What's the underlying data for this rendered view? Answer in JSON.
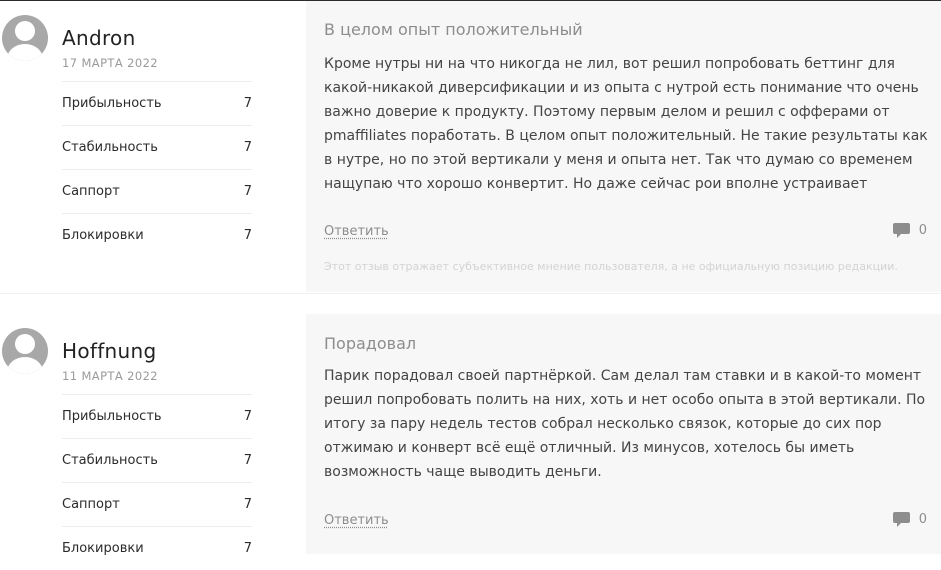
{
  "reviews": [
    {
      "author": "Andron",
      "date": "17 МАРТА 2022",
      "ratings": [
        {
          "label": "Прибыльность",
          "value": "7"
        },
        {
          "label": "Стабильность",
          "value": "7"
        },
        {
          "label": "Саппорт",
          "value": "7"
        },
        {
          "label": "Блокировки",
          "value": "7"
        }
      ],
      "title": "В целом опыт положительный",
      "text": "Кроме нутры ни на что никогда не лил, вот решил попробовать беттинг для какой-никакой диверсификации и из опыта с нутрой есть понимание что очень важно доверие к продукту. Поэтому первым делом и решил с офферами от pmaffiliates поработать. В целом опыт положительный. Не такие результаты как в нутре, но по этой вертикали у меня и опыта нет. Так что думаю со временем нащупаю что хорошо конвертит. Но даже сейчас рои вполне устраивает",
      "reply_label": "Ответить",
      "comment_count": "0",
      "disclaimer": "Этот отзыв отражает субъективное мнение пользователя, а не официальную позицию редакции."
    },
    {
      "author": "Hoffnung",
      "date": "11 МАРТА 2022",
      "ratings": [
        {
          "label": "Прибыльность",
          "value": "7"
        },
        {
          "label": "Стабильность",
          "value": "7"
        },
        {
          "label": "Саппорт",
          "value": "7"
        },
        {
          "label": "Блокировки",
          "value": "7"
        }
      ],
      "title": "Порадовал",
      "text": "Парик порадовал своей партнёркой. Сам делал там ставки и в какой-то момент решил попробовать полить на них, хоть и нет особо опыта в этой вертикали. По итогу за пару недель тестов собрал несколько связок, которые до сих пор отжимаю и конверт всё ещё отличный. Из минусов, хотелось бы иметь возможность чаще выводить деньги.",
      "reply_label": "Ответить",
      "comment_count": "0"
    }
  ],
  "icons": {
    "avatar": "user-avatar-icon",
    "comment": "comment-bubble-icon"
  },
  "colors": {
    "avatar": "#a8a8a8",
    "panel": "#f7f7f7",
    "muted": "#8d8d8d"
  }
}
